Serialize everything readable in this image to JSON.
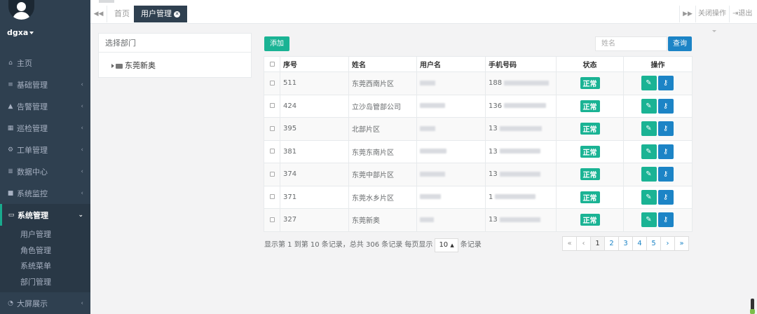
{
  "user": {
    "name": "dgxa"
  },
  "sidebar": {
    "items": [
      {
        "label": "主页",
        "icon": "home-icon",
        "glyph": "⌂"
      },
      {
        "label": "基础管理",
        "icon": "list-icon",
        "glyph": "≡"
      },
      {
        "label": "告警管理",
        "icon": "warning-icon",
        "glyph": "▲"
      },
      {
        "label": "巡检管理",
        "icon": "calendar-icon",
        "glyph": "▦"
      },
      {
        "label": "工单管理",
        "icon": "gears-icon",
        "glyph": "⚙"
      },
      {
        "label": "数据中心",
        "icon": "database-icon",
        "glyph": "≣"
      },
      {
        "label": "系统监控",
        "icon": "video-icon",
        "glyph": "■"
      },
      {
        "label": "系统管理",
        "icon": "desktop-icon",
        "glyph": "▭"
      },
      {
        "label": "大屏展示",
        "icon": "dashboard-icon",
        "glyph": "◔"
      }
    ],
    "submenu": [
      "用户管理",
      "角色管理",
      "系统菜单",
      "部门管理"
    ]
  },
  "tabs": {
    "home": "首页",
    "active": "用户管理",
    "close_ops": "关闭操作",
    "logout": "退出"
  },
  "dept": {
    "header": "选择部门",
    "root": "东莞新奥"
  },
  "toolbar": {
    "add": "添加",
    "search_placeholder": "姓名",
    "search": "查询"
  },
  "table": {
    "headers": [
      "序号",
      "姓名",
      "用户名",
      "手机号码",
      "状态",
      "操作"
    ],
    "rows": [
      {
        "id": "511",
        "name": "东莞西南片区",
        "phone": "188",
        "status": "正常"
      },
      {
        "id": "424",
        "name": "立沙岛管部公司",
        "phone": "136",
        "status": "正常"
      },
      {
        "id": "395",
        "name": "北部片区",
        "phone": "13",
        "status": "正常"
      },
      {
        "id": "381",
        "name": "东莞东南片区",
        "phone": "13",
        "status": "正常"
      },
      {
        "id": "374",
        "name": "东莞中部片区",
        "phone": "13",
        "status": "正常"
      },
      {
        "id": "371",
        "name": "东莞水乡片区",
        "phone": "1",
        "status": "正常"
      },
      {
        "id": "327",
        "name": "东莞新奥",
        "phone": "13",
        "status": "正常"
      }
    ]
  },
  "pagination": {
    "info_before": "显示第 1 到第 10 条记录，总共 306 条记录 每页显示",
    "page_size": "10",
    "info_after": "条记录",
    "first": "«",
    "prev": "‹",
    "pages": [
      "1",
      "2",
      "3",
      "4",
      "5"
    ],
    "next": "›",
    "last": "»"
  },
  "colors": {
    "primary": "#1ab394",
    "info": "#1c84c6",
    "sidebar": "#2f4050"
  }
}
